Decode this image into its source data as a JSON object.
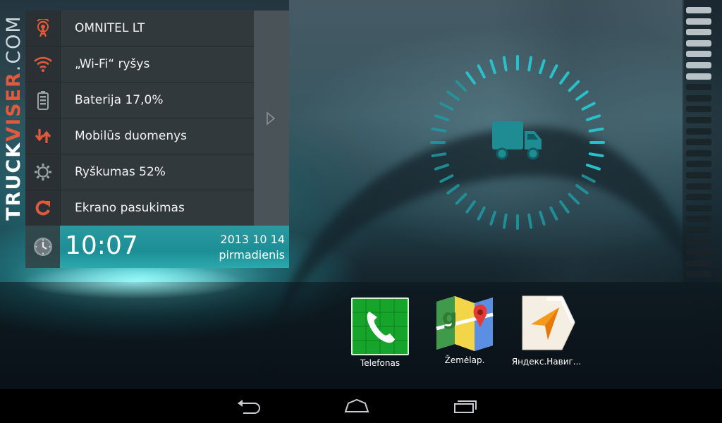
{
  "brand": {
    "part1": "TRUCK",
    "part2": "VISER",
    "part3": ".COM"
  },
  "status_panel": {
    "items": [
      {
        "label": "OMNITEL LT",
        "icon": "cell-tower-icon",
        "color": "#e2593b"
      },
      {
        "label": "„Wi-Fi“ ryšys",
        "icon": "wifi-icon",
        "color": "#e2593b"
      },
      {
        "label": "Baterija 17,0%",
        "icon": "battery-icon",
        "color": "#9aa3a8"
      },
      {
        "label": "Mobilūs duomenys",
        "icon": "mobile-data-arrows-icon",
        "color": "#e2593b"
      },
      {
        "label": "Ryškumas 52%",
        "icon": "brightness-gear-icon",
        "color": "#9aa3a8"
      },
      {
        "label": "Ekrano pasukimas",
        "icon": "rotate-icon",
        "color": "#e2593b"
      }
    ],
    "expand_icon": "chevron-right-icon"
  },
  "clock": {
    "time": "10:07",
    "date": "2013 10 14",
    "weekday": "pirmadienis"
  },
  "gauge": {
    "icon": "truck-icon",
    "color": "#1fb5bd"
  },
  "dock": {
    "apps": [
      {
        "label": "Telefonas",
        "icon": "phone-app-icon"
      },
      {
        "label": "Žemėlap.",
        "icon": "maps-app-icon"
      },
      {
        "label": "Яндекс.Навиг...",
        "icon": "yandex-navigator-app-icon"
      }
    ]
  },
  "navbar": {
    "back": "back-icon",
    "home": "home-icon",
    "recents": "recents-icon"
  }
}
